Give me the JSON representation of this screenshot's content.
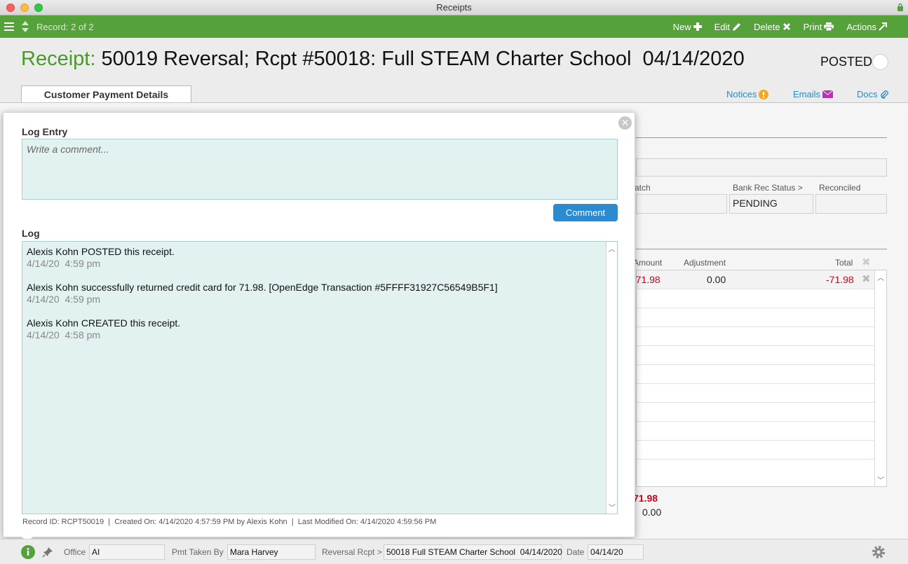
{
  "window": {
    "title": "Receipts"
  },
  "toolbar": {
    "record": "Record: 2 of 2",
    "new_label": "New",
    "edit_label": "Edit",
    "delete_label": "Delete",
    "print_label": "Print",
    "actions_label": "Actions"
  },
  "header": {
    "label": "Receipt:",
    "title": "50019 Reversal; Rcpt #50018: Full STEAM Charter School  04/14/2020",
    "status": "POSTED"
  },
  "tabs": {
    "active": "Customer Payment Details"
  },
  "links": {
    "notices": "Notices",
    "emails": "Emails",
    "docs": "Docs"
  },
  "background": {
    "batch_label": "atch",
    "bank_rec_label": "Bank Rec Status >",
    "bank_rec_value": "PENDING",
    "reconciled_label": "Reconciled",
    "col_amount": "Amount",
    "col_adjustment": "Adjustment",
    "col_total": "Total",
    "row_amount": "-71.98",
    "row_adjustment": "0.00",
    "row_total": "-71.98",
    "sum_total": "71.98",
    "sum_adj": "0.00"
  },
  "modal": {
    "entry_label": "Log Entry",
    "placeholder": "Write a comment...",
    "comment_button": "Comment",
    "log_label": "Log",
    "log": [
      {
        "text": "Alexis Kohn POSTED this receipt.",
        "time": "4/14/20  4:59 pm"
      },
      {
        "text": "Alexis Kohn successfully returned credit card for 71.98. [OpenEdge Transaction #5FFFF31927C56549B5F1]",
        "time": "4/14/20  4:59 pm"
      },
      {
        "text": "Alexis Kohn CREATED this receipt.",
        "time": "4/14/20  4:58 pm"
      }
    ],
    "meta": "Record ID: RCPT50019  |  Created On: 4/14/2020 4:57:59 PM by Alexis Kohn  |  Last Modified On: 4/14/2020 4:59:56 PM"
  },
  "statusbar": {
    "office_label": "Office",
    "office_value": "AI",
    "pmt_label": "Pmt Taken By",
    "pmt_value": "Mara Harvey",
    "rev_label": "Reversal Rcpt >",
    "rev_value": "50018 Full STEAM Charter School  04/14/2020",
    "date_label": "Date",
    "date_value": "04/14/20"
  },
  "colors": {
    "accent": "#55a23a",
    "link": "#2a8bc2",
    "negative": "#d0021b",
    "button": "#2a8bd1"
  }
}
